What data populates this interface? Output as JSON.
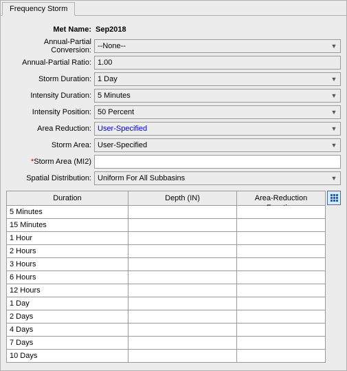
{
  "tab": {
    "label": "Frequency Storm"
  },
  "form": {
    "met_name": {
      "label": "Met Name:",
      "value": "Sep2018"
    },
    "annual_partial_conversion": {
      "label": "Annual-Partial Conversion:",
      "value": "--None--"
    },
    "annual_partial_ratio": {
      "label": "Annual-Partial Ratio:",
      "value": "1.00"
    },
    "storm_duration": {
      "label": "Storm Duration:",
      "value": "1 Day"
    },
    "intensity_duration": {
      "label": "Intensity Duration:",
      "value": "5 Minutes"
    },
    "intensity_position": {
      "label": "Intensity Position:",
      "value": "50 Percent"
    },
    "area_reduction": {
      "label": "Area Reduction:",
      "value": "User-Specified"
    },
    "storm_area": {
      "label": "Storm Area:",
      "value": "User-Specified"
    },
    "storm_area_mi2": {
      "label": "Storm Area (MI2)",
      "req": "*",
      "value": ""
    },
    "spatial_distribution": {
      "label": "Spatial Distribution:",
      "value": "Uniform For All Subbasins"
    }
  },
  "table": {
    "headers": {
      "duration": "Duration",
      "depth": "Depth (IN)",
      "arf": "Area-Reduction Function"
    },
    "rows": [
      {
        "duration": "5 Minutes",
        "depth": "",
        "arf": ""
      },
      {
        "duration": "15 Minutes",
        "depth": "",
        "arf": ""
      },
      {
        "duration": "1 Hour",
        "depth": "",
        "arf": ""
      },
      {
        "duration": "2 Hours",
        "depth": "",
        "arf": ""
      },
      {
        "duration": "3 Hours",
        "depth": "",
        "arf": ""
      },
      {
        "duration": "6 Hours",
        "depth": "",
        "arf": ""
      },
      {
        "duration": "12 Hours",
        "depth": "",
        "arf": ""
      },
      {
        "duration": "1 Day",
        "depth": "",
        "arf": ""
      },
      {
        "duration": "2 Days",
        "depth": "",
        "arf": ""
      },
      {
        "duration": "4 Days",
        "depth": "",
        "arf": ""
      },
      {
        "duration": "7 Days",
        "depth": "",
        "arf": ""
      },
      {
        "duration": "10 Days",
        "depth": "",
        "arf": ""
      }
    ]
  }
}
